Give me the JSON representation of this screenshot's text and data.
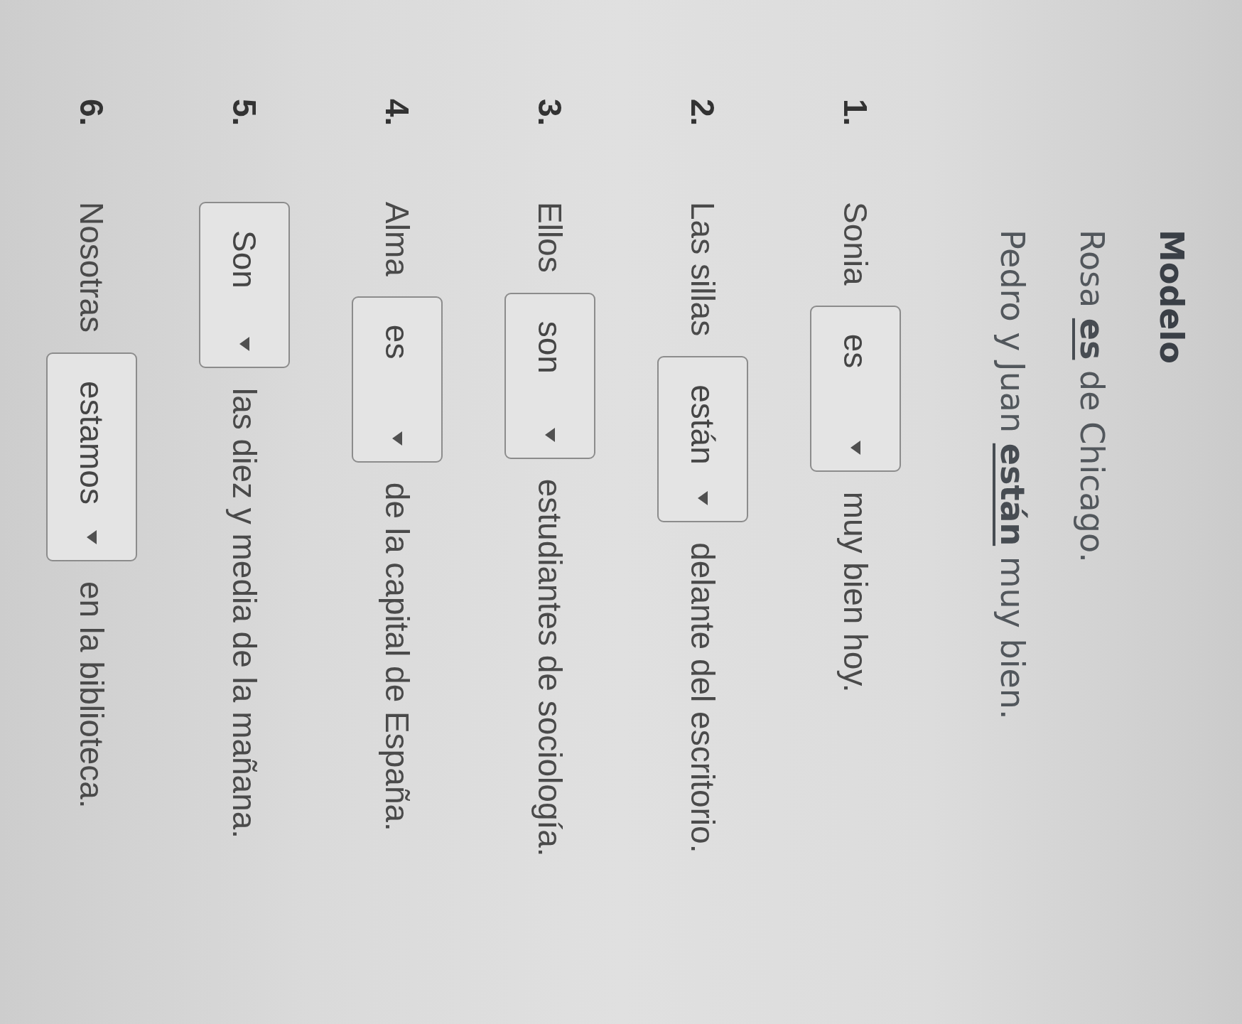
{
  "model": {
    "heading": "Modelo",
    "examples": [
      "Rosa **es** de Chicago.",
      "Pedro y Juan **están** muy bien."
    ]
  },
  "items": [
    {
      "number": "1.",
      "parts": [
        {
          "kind": "text",
          "text": "Sonia"
        },
        {
          "kind": "dropdown",
          "value": "es"
        },
        {
          "kind": "text",
          "text": "muy bien hoy."
        }
      ]
    },
    {
      "number": "2.",
      "parts": [
        {
          "kind": "text",
          "text": "Las sillas"
        },
        {
          "kind": "dropdown",
          "value": "están"
        },
        {
          "kind": "text",
          "text": "delante del escritorio."
        }
      ]
    },
    {
      "number": "3.",
      "parts": [
        {
          "kind": "text",
          "text": "Ellos"
        },
        {
          "kind": "dropdown",
          "value": "son"
        },
        {
          "kind": "text",
          "text": "estudiantes de sociología."
        }
      ]
    },
    {
      "number": "4.",
      "parts": [
        {
          "kind": "text",
          "text": "Alma"
        },
        {
          "kind": "dropdown",
          "value": "es"
        },
        {
          "kind": "text",
          "text": "de la capital de España."
        }
      ]
    },
    {
      "number": "5.",
      "parts": [
        {
          "kind": "dropdown",
          "value": "Son"
        },
        {
          "kind": "text",
          "text": "las diez y media de la mañana."
        }
      ]
    },
    {
      "number": "6.",
      "parts": [
        {
          "kind": "text",
          "text": "Nosotras"
        },
        {
          "kind": "dropdown",
          "value": "estamos"
        },
        {
          "kind": "text",
          "text": "en la biblioteca."
        }
      ]
    }
  ]
}
